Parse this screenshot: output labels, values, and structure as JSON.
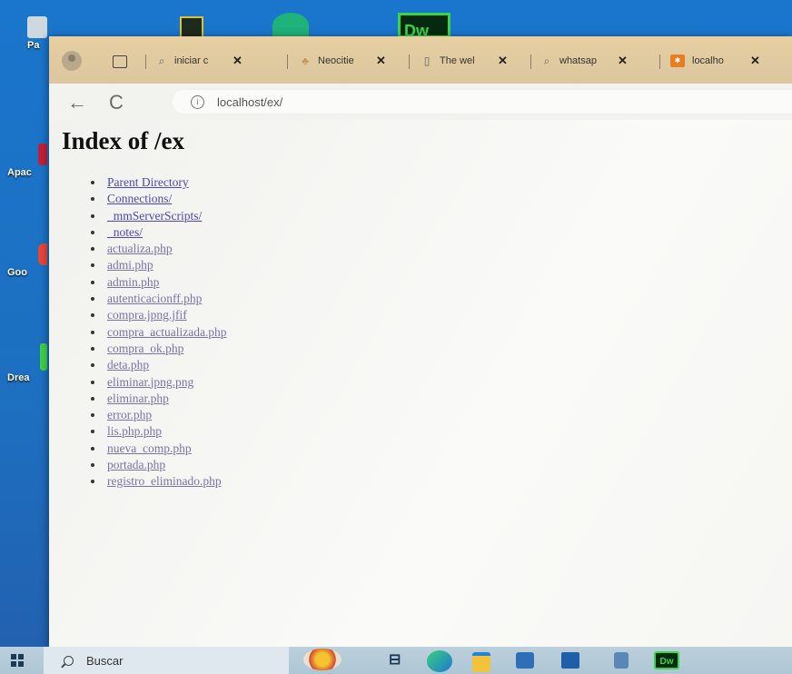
{
  "desktop": {
    "icons": [
      {
        "label": "Pa",
        "name": "recycle-bin-desktop-icon"
      },
      {
        "label": "Apac",
        "name": "apache-desktop-icon"
      },
      {
        "label": "Goo",
        "name": "google-chrome-desktop-icon"
      },
      {
        "label": "Drea",
        "name": "dreamweaver-desktop-icon"
      }
    ]
  },
  "browser": {
    "tabs": [
      {
        "title": "iniciar c",
        "icon": "search-icon"
      },
      {
        "title": "Neocitie",
        "icon": "cat-icon"
      },
      {
        "title": "The wel",
        "icon": "document-icon"
      },
      {
        "title": "whatsap",
        "icon": "search-icon"
      },
      {
        "title": "localho",
        "icon": "xampp-icon"
      }
    ],
    "address": "localhost/ex/"
  },
  "page": {
    "title": "Index of /ex",
    "entries": [
      "Parent Directory",
      "Connections/",
      "_mmServerScripts/",
      "_notes/",
      "actualiza.php",
      "admi.php",
      "admin.php",
      "autenticacionff.php",
      "compra.jpng.jfif",
      "compra_actualizada.php",
      "compra_ok.php",
      "deta.php",
      "eliminar.jpng.png",
      "eliminar.php",
      "error.php",
      "lis.php.php",
      "nueva_comp.php",
      "portada.php",
      "registro_eliminado.php"
    ]
  },
  "taskbar": {
    "search_label": "Buscar",
    "pinned": [
      "widgets-icon",
      "task-view-icon",
      "edge-icon",
      "file-explorer-icon",
      "store-icon",
      "mail-icon",
      "notepad-icon",
      "dreamweaver-icon"
    ]
  }
}
